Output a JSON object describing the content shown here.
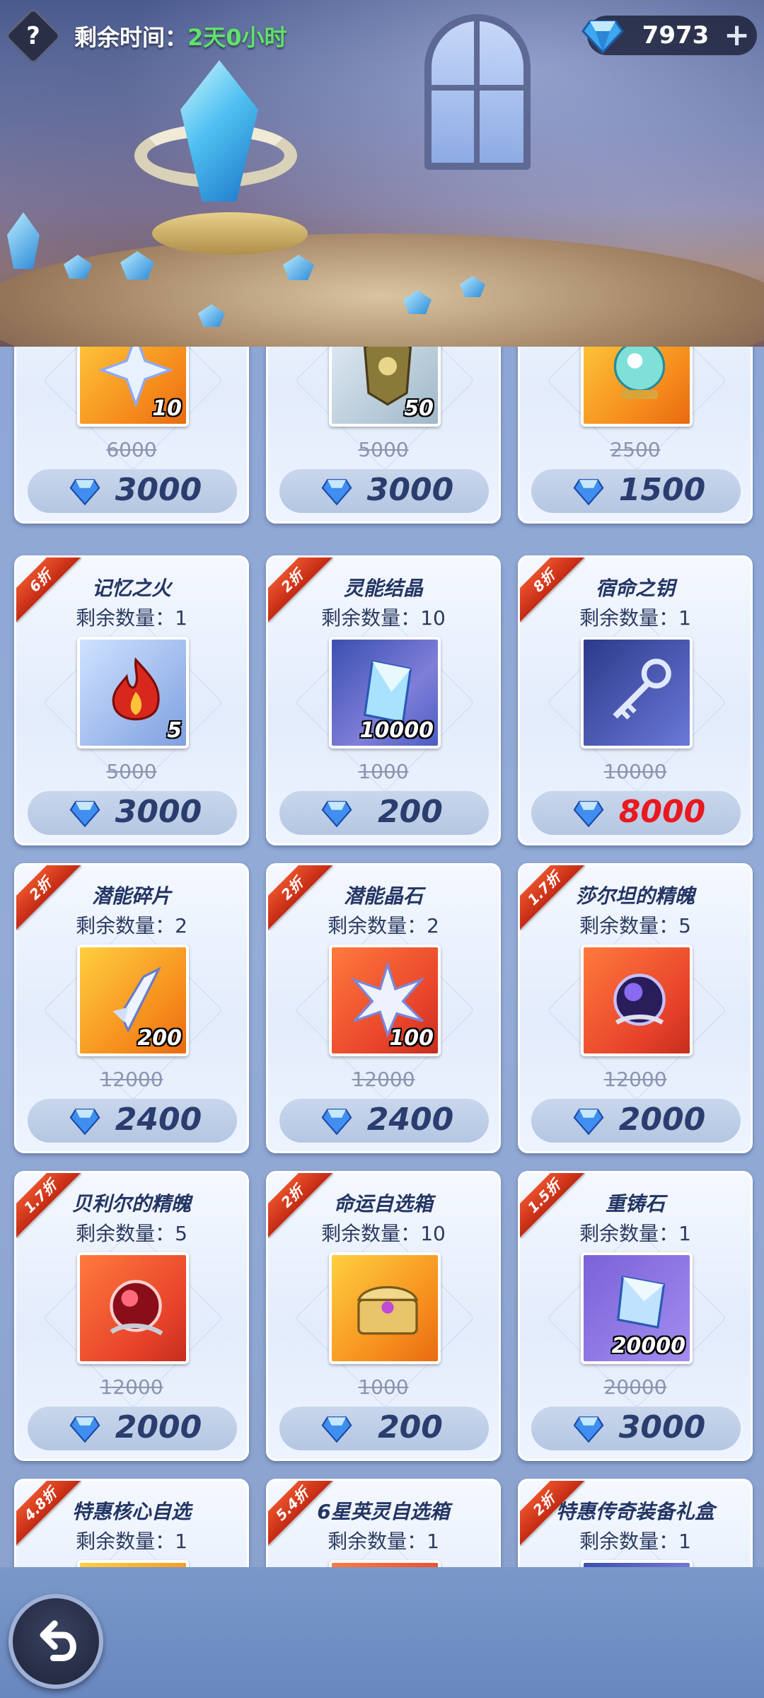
{
  "header": {
    "help_icon": "question-icon",
    "timer_label": "剩余时间：",
    "timer_value": "2天0小时",
    "currency_amount": "7973",
    "currency_plus": "+"
  },
  "colors": {
    "price_text": "#2a3d6e",
    "price_highlight": "#e8191f",
    "ribbon": "#d63a1e",
    "timer_value": "#5fe26a"
  },
  "shop": {
    "top_row": [
      {
        "qty": "10",
        "original": "6000",
        "price": "3000",
        "icon": "star-shard-icon"
      },
      {
        "qty": "50",
        "original": "5000",
        "price": "3000",
        "icon": "armor-hero-icon"
      },
      {
        "qty": "",
        "original": "2500",
        "price": "1500",
        "icon": "crystal-orb-icon"
      }
    ],
    "items": [
      {
        "discount": "6折",
        "name": "记忆之火",
        "stock_label": "剩余数量：",
        "stock": "1",
        "qty": "5",
        "original": "5000",
        "price": "3000",
        "icon": "flame-icon",
        "highlight": false
      },
      {
        "discount": "2折",
        "name": "灵能结晶",
        "stock_label": "剩余数量：",
        "stock": "10",
        "qty": "10000",
        "original": "1000",
        "price": "200",
        "icon": "crystal-icon",
        "highlight": false
      },
      {
        "discount": "8折",
        "name": "宿命之钥",
        "stock_label": "剩余数量：",
        "stock": "1",
        "qty": "",
        "original": "10000",
        "price": "8000",
        "icon": "key-icon",
        "highlight": true
      },
      {
        "discount": "2折",
        "name": "潜能碎片",
        "stock_label": "剩余数量：",
        "stock": "2",
        "qty": "200",
        "original": "12000",
        "price": "2400",
        "icon": "shard-icon",
        "highlight": false
      },
      {
        "discount": "2折",
        "name": "潜能晶石",
        "stock_label": "剩余数量：",
        "stock": "2",
        "qty": "100",
        "original": "12000",
        "price": "2400",
        "icon": "star-crystal-icon",
        "highlight": false
      },
      {
        "discount": "1.7折",
        "name": "莎尔坦的精魄",
        "stock_label": "剩余数量：",
        "stock": "5",
        "qty": "",
        "original": "12000",
        "price": "2000",
        "icon": "dark-orb-icon",
        "highlight": false
      },
      {
        "discount": "1.7折",
        "name": "贝利尔的精魄",
        "stock_label": "剩余数量：",
        "stock": "5",
        "qty": "",
        "original": "12000",
        "price": "2000",
        "icon": "red-orb-icon",
        "highlight": false
      },
      {
        "discount": "2折",
        "name": "命运自选箱",
        "stock_label": "剩余数量：",
        "stock": "10",
        "qty": "",
        "original": "1000",
        "price": "200",
        "icon": "chest-icon",
        "highlight": false
      },
      {
        "discount": "1.5折",
        "name": "重铸石",
        "stock_label": "剩余数量：",
        "stock": "1",
        "qty": "20000",
        "original": "20000",
        "price": "3000",
        "icon": "reforge-stone-icon",
        "highlight": false
      },
      {
        "discount": "4.8折",
        "name": "特惠核心自选",
        "stock_label": "剩余数量：",
        "stock": "1",
        "qty": "",
        "original": "",
        "price": "",
        "icon": "core-box-icon",
        "highlight": false
      },
      {
        "discount": "5.4折",
        "name": "6星英灵自选箱",
        "stock_label": "剩余数量：",
        "stock": "1",
        "qty": "",
        "original": "",
        "price": "",
        "icon": "hero-box-icon",
        "highlight": false
      },
      {
        "discount": "2折",
        "name": "特惠传奇装备礼盒",
        "stock_label": "剩余数量：",
        "stock": "1",
        "qty": "",
        "original": "",
        "price": "",
        "icon": "gear-box-icon",
        "highlight": false
      }
    ]
  },
  "footer": {
    "back_icon": "back-arrow-icon"
  }
}
